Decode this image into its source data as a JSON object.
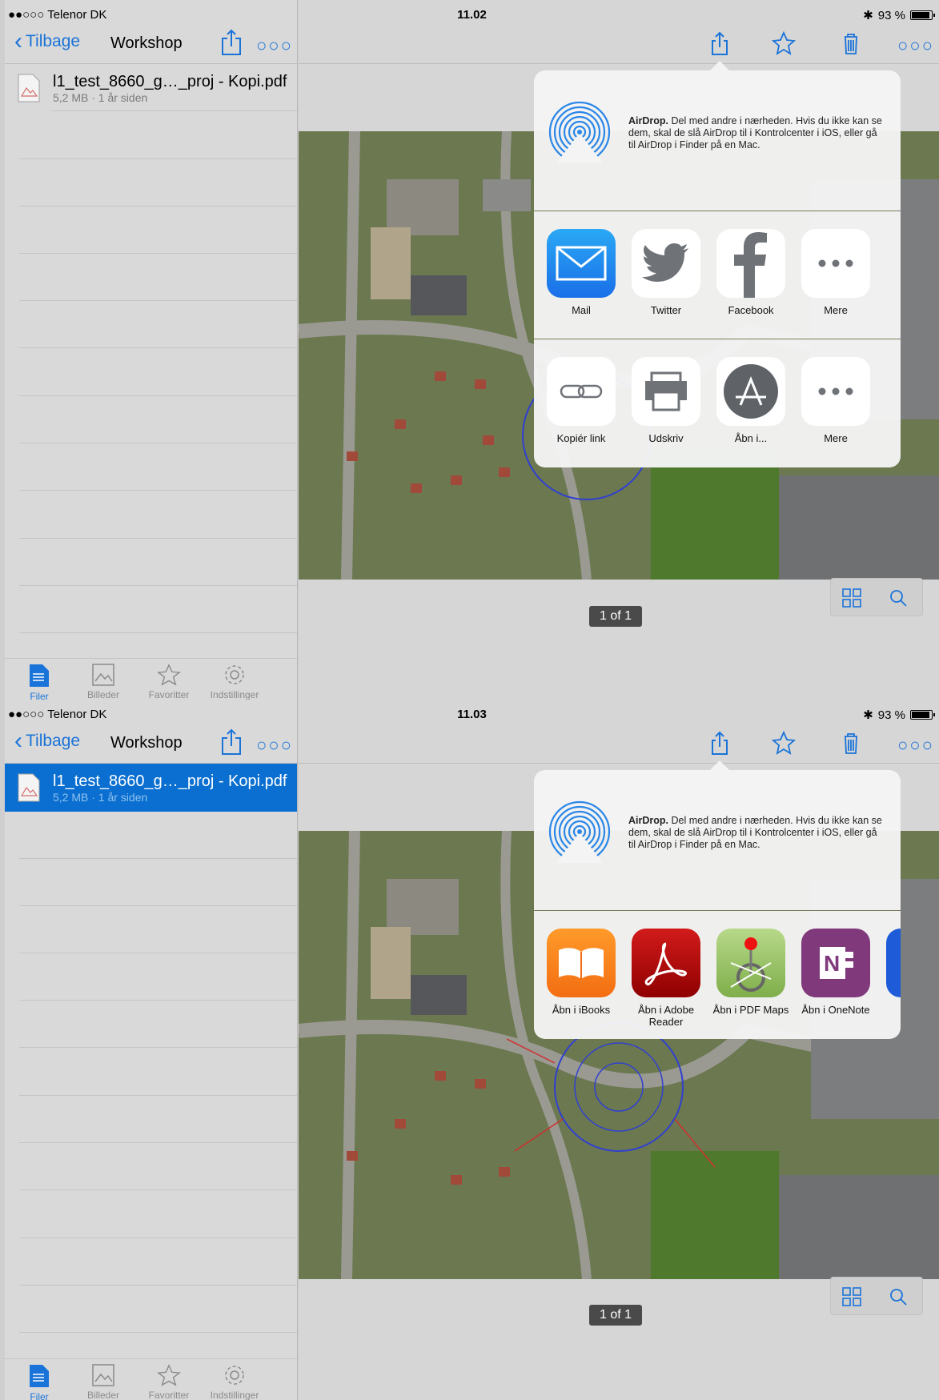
{
  "colors": {
    "accent": "#1a73d9",
    "selection": "#0a6fd0"
  },
  "screens": [
    {
      "status": {
        "carrier": "●●○○○ Telenor DK",
        "time": "11.02",
        "battery": "93 %"
      },
      "nav": {
        "back": "Tilbage",
        "title": "Workshop"
      },
      "file": {
        "name": "l1_test_8660_g…_proj - Kopi.pdf",
        "meta": "5,2 MB · 1 år siden"
      },
      "tabs": [
        "Filer",
        "Billeder",
        "Favoritter",
        "Indstillinger"
      ],
      "page_indicator": "1 of 1",
      "share": {
        "airdrop_title": "AirDrop.",
        "airdrop_text": "Del med andre i nærheden. Hvis du ikke kan se dem, skal de slå AirDrop til i Kontrolcenter i iOS, eller gå til AirDrop i Finder på en Mac.",
        "row1": [
          "Mail",
          "Twitter",
          "Facebook",
          "Mere"
        ],
        "row2": [
          "Kopiér link",
          "Udskriv",
          "Åbn i...",
          "Mere"
        ]
      }
    },
    {
      "status": {
        "carrier": "●●○○○ Telenor DK",
        "time": "11.03",
        "battery": "93 %"
      },
      "nav": {
        "back": "Tilbage",
        "title": "Workshop"
      },
      "file": {
        "name": "l1_test_8660_g…_proj - Kopi.pdf",
        "meta": "5,2 MB · 1 år siden"
      },
      "tabs": [
        "Filer",
        "Billeder",
        "Favoritter",
        "Indstillinger"
      ],
      "page_indicator": "1 of 1",
      "share": {
        "airdrop_title": "AirDrop.",
        "airdrop_text": "Del med andre i nærheden. Hvis du ikke kan se dem, skal de slå AirDrop til i Kontrolcenter i iOS, eller gå til AirDrop i Finder på en Mac.",
        "open_in": [
          "Åbn i iBooks",
          "Åbn i Adobe Reader",
          "Åbn i PDF Maps",
          "Åbn i OneNote",
          "Åb"
        ]
      }
    }
  ]
}
